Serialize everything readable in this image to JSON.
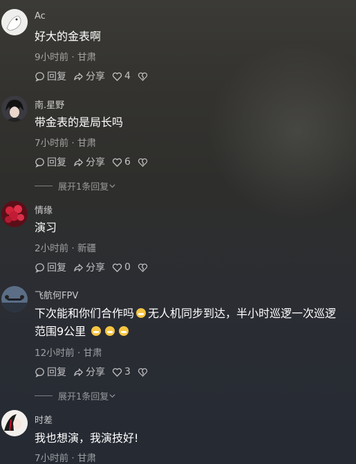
{
  "comments": [
    {
      "user": "Ac",
      "text": "好大的金表啊",
      "meta": "9小时前 · 甘肃",
      "reply": "回复",
      "share": "分享",
      "likes": "4"
    },
    {
      "user": "南.星野",
      "text": "带金表的是局长吗",
      "meta": "7小时前 · 甘肃",
      "reply": "回复",
      "share": "分享",
      "likes": "6",
      "expand": "展开1条回复"
    },
    {
      "user": "情缘",
      "text": "演习",
      "meta": "2小时前 · 新疆",
      "reply": "回复",
      "share": "分享",
      "likes": "0"
    },
    {
      "user": "飞航何FPV",
      "text_a": "下次能和你们合作吗",
      "text_b": "无人机同步到达，半小时巡逻一次巡逻",
      "text_c": "范围9公里",
      "meta": "12小时前 · 甘肃",
      "reply": "回复",
      "share": "分享",
      "likes": "3",
      "expand": "展开1条回复"
    },
    {
      "user": "时差",
      "text": "我也想演，我演技好!",
      "meta": "7小时前 · 甘肃"
    }
  ],
  "icons": {
    "comment": "speech-bubble-icon",
    "share": "share-arrow-icon",
    "like": "heart-icon",
    "dislike": "broken-heart-icon",
    "emoji": "grin-emoji-icon"
  }
}
